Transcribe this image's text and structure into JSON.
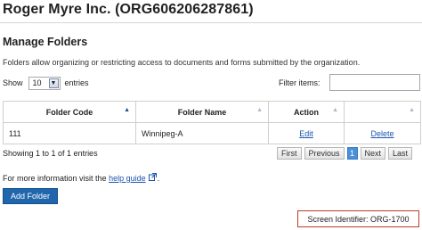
{
  "header": {
    "org_title": "Roger Myre Inc. (ORG606206287861)"
  },
  "section": {
    "title": "Manage Folders",
    "description": "Folders allow organizing or restricting access to documents and forms submitted by the organization."
  },
  "controls": {
    "show_label": "Show",
    "entries_value": "10",
    "entries_label": "entries",
    "filter_label": "Filter items:",
    "filter_value": ""
  },
  "table": {
    "columns": [
      "Folder Code",
      "Folder Name",
      "Action",
      ""
    ],
    "rows": [
      {
        "code": "111",
        "name": "Winnipeg-A",
        "edit": "Edit",
        "delete": "Delete"
      }
    ]
  },
  "pagination": {
    "summary": "Showing 1 to 1 of 1 entries",
    "first": "First",
    "previous": "Previous",
    "current": "1",
    "next": "Next",
    "last": "Last"
  },
  "info": {
    "prefix": "For more information visit the",
    "link": "help guide",
    "suffix": "."
  },
  "actions": {
    "add_folder": "Add Folder"
  },
  "footer": {
    "screen_identifier": "Screen Identifier: ORG-1700"
  },
  "colors": {
    "accent": "#1f66ad",
    "link": "#1a55b0",
    "highlight_border": "#c0392b",
    "active_page": "#4a90d9"
  },
  "icons": [
    "sort-arrow-icon",
    "external-link-icon",
    "chevron-down-icon"
  ]
}
